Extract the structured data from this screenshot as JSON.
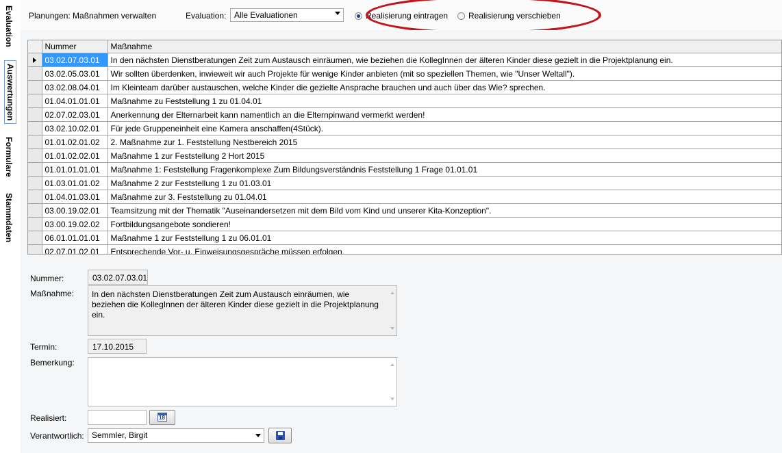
{
  "sidebar": {
    "tabs": [
      "Evaluation",
      "Auswertungen",
      "Formulare",
      "Stammdaten"
    ]
  },
  "toolbar": {
    "title": "Planungen: Maßnahmen verwalten",
    "evaluation_label": "Evaluation:",
    "evaluation_value": "Alle Evaluationen",
    "radio_1": "Realisierung eintragen",
    "radio_2": "Realisierung verschieben",
    "radio_selected": "Realisierung eintragen"
  },
  "grid": {
    "columns": [
      "Nummer",
      "Maßnahme"
    ],
    "rows": [
      [
        "03.02.07.03.01",
        "In den nächsten Dienstberatungen Zeit zum Austausch einräumen, wie beziehen die KollegInnen der älteren Kinder diese gezielt in die Projektplanung ein."
      ],
      [
        "03.02.05.03.01",
        "Wir sollten überdenken, inwieweit wir auch Projekte für wenige Kinder anbieten (mit so speziellen Themen, wie \"Unser Weltall\")."
      ],
      [
        "03.02.08.04.01",
        "Im Kleinteam darüber austauschen, welche Kinder die gezielte Ansprache brauchen und auch über das Wie? sprechen."
      ],
      [
        "01.04.01.01.01",
        "Maßnahme zu Feststellung 1 zu 01.04.01"
      ],
      [
        "02.07.02.03.01",
        "Anerkennung der Elternarbeit kann namentlich an die Elternpinwand vermerkt werden!"
      ],
      [
        "03.02.10.02.01",
        "Für jede Gruppeneinheit eine Kamera anschaffen(4Stück)."
      ],
      [
        "01.01.02.01.02",
        "2. Maßnahme zur 1. Feststellung Nestbereich 2015"
      ],
      [
        "01.01.02.02.01",
        "Maßnahme 1 zur Feststellung 2 Hort 2015"
      ],
      [
        "01.01.01.01.01",
        "Maßnahme 1: Feststellung Fragenkomplexe Zum Bildungsverständnis Feststellung 1 Frage 01.01.01"
      ],
      [
        "01.03.01.01.02",
        "Maßnahme 2 zur Feststellung 1 zu 01.03.01"
      ],
      [
        "01.04.01.03.01",
        "Maßnahme zur 3. Feststellung zu 01.04.01"
      ],
      [
        "03.00.19.02.01",
        "Teamsitzung mit der Thematik \"Auseinandersetzen mit dem Bild vom Kind und unserer Kita-Konzeption\"."
      ],
      [
        "03.00.19.02.02",
        "Fortbildungsangebote sondieren!"
      ],
      [
        "06.01.01.01.01",
        "Maßnahme 1 zur Feststellung 1 zu 06.01.01"
      ],
      [
        "02.07.01.02.01",
        "Entsprechende Vor- u. Einweisungsgespräche müssen erfolgen."
      ]
    ]
  },
  "form": {
    "nummer_label": "Nummer:",
    "nummer_value": "03.02.07.03.01",
    "massnahme_label": "Maßnahme:",
    "massnahme_value": "In den nächsten Dienstberatungen Zeit zum Austausch einräumen, wie beziehen die KollegInnen der älteren Kinder diese gezielt in die Projektplanung ein.",
    "termin_label": "Termin:",
    "termin_value": "17.10.2015",
    "bemerkung_label": "Bemerkung:",
    "bemerkung_value": "",
    "realisiert_label": "Realisiert:",
    "realisiert_value": "",
    "calendar_day": "18",
    "verantwortlich_label": "Verantwortlich:",
    "verantwortlich_value": "Semmler, Birgit"
  },
  "colors": {
    "selection": "#3399ff",
    "highlight_ellipse": "#c0171f"
  }
}
